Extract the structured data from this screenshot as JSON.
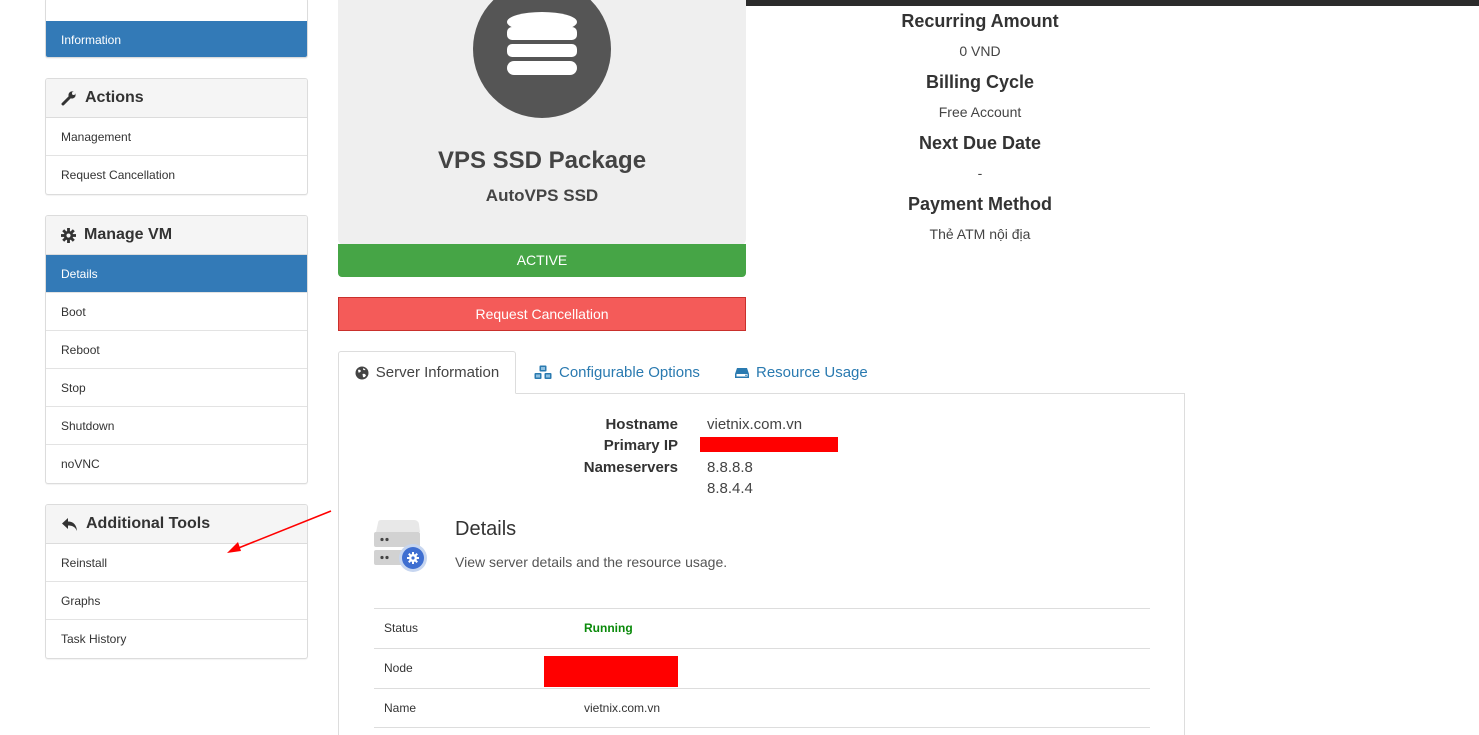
{
  "sidebar": {
    "info_item": "Information",
    "actions": {
      "title": "Actions",
      "items": [
        "Management",
        "Request Cancellation"
      ]
    },
    "manage_vm": {
      "title": "Manage VM",
      "items": [
        "Details",
        "Boot",
        "Reboot",
        "Stop",
        "Shutdown",
        "noVNC"
      ]
    },
    "tools": {
      "title": "Additional Tools",
      "items": [
        "Reinstall",
        "Graphs",
        "Task History"
      ]
    }
  },
  "product": {
    "name": "VPS SSD Package",
    "group": "AutoVPS SSD",
    "status": "ACTIVE",
    "cancel_label": "Request Cancellation"
  },
  "billing": {
    "recurring_label": "Recurring Amount",
    "recurring_value": "0 VND",
    "cycle_label": "Billing Cycle",
    "cycle_value": "Free Account",
    "due_label": "Next Due Date",
    "due_value": "-",
    "payment_label": "Payment Method",
    "payment_value": "Thẻ ATM nội địa"
  },
  "tabs": [
    "Server Information",
    "Configurable Options",
    "Resource Usage"
  ],
  "server": {
    "hostname_label": "Hostname",
    "hostname": "vietnix.com.vn",
    "ip_label": "Primary IP",
    "ns_label": "Nameservers",
    "ns1": "8.8.8.8",
    "ns2": "8.8.4.4"
  },
  "details": {
    "title": "Details",
    "subtitle": "View server details and the resource usage.",
    "rows": [
      {
        "key": "Status",
        "value": "Running"
      },
      {
        "key": "Node",
        "value": ""
      },
      {
        "key": "Name",
        "value": "vietnix.com.vn"
      }
    ]
  },
  "colors": {
    "primary": "#337ab7",
    "success": "#46a546",
    "danger": "#f45b59",
    "redaction": "#ff0000"
  }
}
